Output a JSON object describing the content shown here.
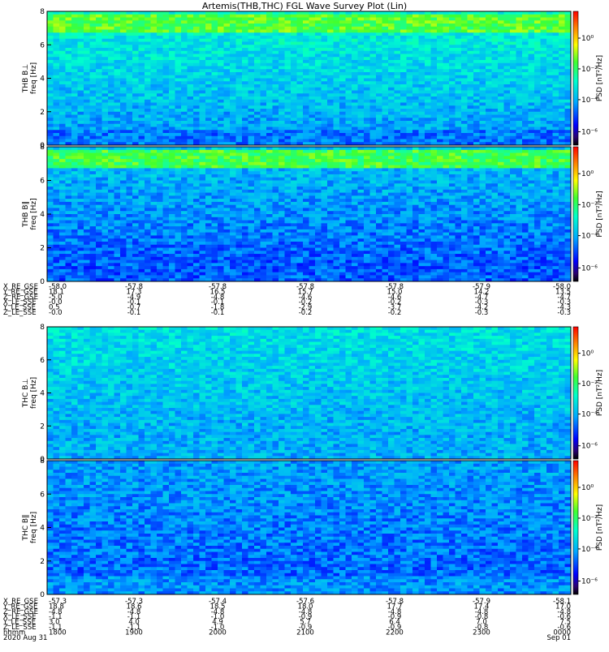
{
  "chart_data": {
    "type": "heatmap",
    "title": "Artemis(THB,THC) FGL Wave Survey Plot (Lin)",
    "colorbar": {
      "label": "PSD [nT²/Hz]",
      "tick_labels": [
        "10⁰",
        "10⁻²",
        "10⁻⁴",
        "10⁻⁶"
      ],
      "scale": "log",
      "colormap": "rainbow"
    },
    "y_axis": {
      "label": "freq [Hz]",
      "ylim": [
        0,
        8
      ],
      "tick_labels": [
        "0",
        "2",
        "4",
        "6",
        "8"
      ]
    },
    "panels": [
      {
        "name": "THB B⊥",
        "label": "THB B⊥",
        "features": "strong band near 7 Hz, lines near 0.5–1 Hz"
      },
      {
        "name": "THB B∥",
        "label": "THB B∥",
        "features": "strong band near 7 Hz, lines near 0.5–1 Hz"
      },
      {
        "name": "THC B⊥",
        "label": "THC B⊥",
        "features": "enhanced power at low frequency"
      },
      {
        "name": "THC B∥",
        "label": "THC B∥",
        "features": "enhanced power below 1 Hz"
      }
    ],
    "ephemeris_thb": {
      "rows": [
        {
          "label": "X_RE_GSE",
          "values": [
            "-58.0",
            "-57.8",
            "-57.8",
            "-57.8",
            "-57.8",
            "-57.9",
            "-58.0"
          ]
        },
        {
          "label": "Y_RE_GSE",
          "values": [
            "18.1",
            "17.3",
            "16.5",
            "15.7",
            "15.0",
            "14.2",
            "13.5"
          ]
        },
        {
          "label": "Z_RE_GSE",
          "values": [
            "-5.0",
            "-4.9",
            "-4.8",
            "-4.6",
            "-4.6",
            "-4.7",
            "-4.7"
          ]
        },
        {
          "label": "X_LE_SSE",
          "values": [
            "-0.0",
            "-0.1",
            "-0.1",
            "-0.2",
            "-0.2",
            "-0.3",
            "-0.3"
          ]
        },
        {
          "label": "Y_LE_SSE",
          "values": [
            "0.5",
            "-0.7",
            "-1.8",
            "-2.9",
            "-3.7",
            "-4.2",
            "-4.3"
          ]
        },
        {
          "label": "Z_LE_SSE",
          "values": [
            "-0.0",
            "-0.1",
            "-0.1",
            "-0.2",
            "-0.2",
            "-0.3",
            "-0.3"
          ]
        }
      ]
    },
    "ephemeris_thc": {
      "rows": [
        {
          "label": "X_RE_GSE",
          "values": [
            "-57.3",
            "-57.3",
            "-57.4",
            "-57.6",
            "-57.8",
            "-57.9",
            "-58.1"
          ]
        },
        {
          "label": "Y_RE_GSE",
          "values": [
            "18.8",
            "18.6",
            "18.5",
            "18.0",
            "17.7",
            "17.4",
            "17.0"
          ]
        },
        {
          "label": "Z_RE_GSE",
          "values": [
            "-4.8",
            "-4.8",
            "-4.8",
            "-4.8",
            "-4.8",
            "-4.8",
            "-4.8"
          ]
        },
        {
          "label": "X_LE_SSE",
          "values": [
            "-1.1",
            "-1.1",
            "-1.0",
            "-0.9",
            "-0.9",
            "-0.8",
            "-0.6"
          ]
        },
        {
          "label": "Y_LE_SSE",
          "values": [
            "3.0",
            "4.0",
            "4.9",
            "5.7",
            "6.4",
            "7.0",
            "7.5"
          ]
        },
        {
          "label": "Z_LE_SSE",
          "values": [
            "-1.1",
            "-1.1",
            "-1.0",
            "-0.9",
            "-0.9",
            "-0.8",
            "-0.6"
          ]
        }
      ],
      "time_row": {
        "label": "hhmm",
        "values": [
          "1800",
          "1900",
          "2000",
          "2100",
          "2200",
          "2300",
          "0000"
        ]
      },
      "date_row": {
        "label": "2020 Aug 31",
        "end_label": "Sep 01"
      }
    }
  }
}
